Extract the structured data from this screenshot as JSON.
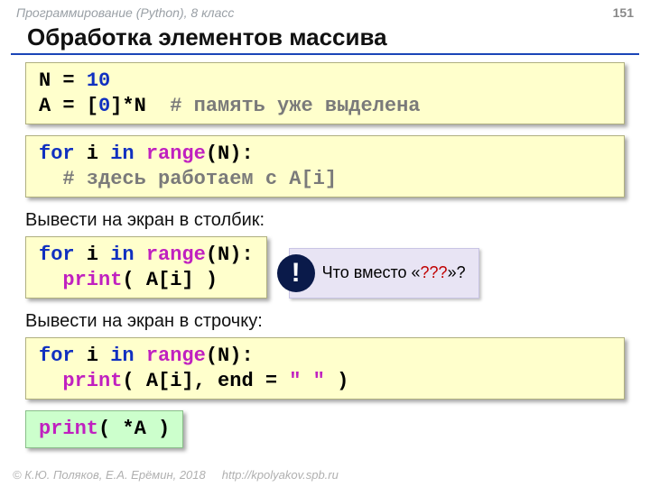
{
  "header": {
    "course": "Программирование (Python), 8 класс",
    "page": "151"
  },
  "title": "Обработка элементов массива",
  "code1": {
    "l1a": "N",
    "l1b": " = ",
    "l1c": "10",
    "l2a": "A",
    "l2b": " = [",
    "l2c": "0",
    "l2d": "]*N  ",
    "comment": "# память уже выделена"
  },
  "code2": {
    "l1a": "for",
    "l1b": " i ",
    "l1c": "in",
    "l1d": " ",
    "l1e": "range",
    "l1f": "(N):",
    "comment": "  # здесь работаем с A[i]"
  },
  "sub1": "Вывести на экран в столбик:",
  "code3": {
    "l1a": "for",
    "l1b": " i ",
    "l1c": "in",
    "l1d": " ",
    "l1e": "range",
    "l1f": "(N):",
    "l2a": "  ",
    "l2b": "print",
    "l2c": "( A[i] )"
  },
  "callout": {
    "prefix": "Что вместо «",
    "q": "???",
    "suffix": "»?"
  },
  "sub2": "Вывести на экран в строчку:",
  "code4": {
    "l1a": "for",
    "l1b": " i ",
    "l1c": "in",
    "l1d": " ",
    "l1e": "range",
    "l1f": "(N):",
    "l2a": "  ",
    "l2b": "print",
    "l2c": "( A[i], end = ",
    "l2d": "\" \"",
    "l2e": " )"
  },
  "code5": {
    "a": "print",
    "b": "( *A )"
  },
  "footer": {
    "copyright": "© К.Ю. Поляков, Е.А. Ерёмин, 2018",
    "url": "http://kpolyakov.spb.ru"
  }
}
